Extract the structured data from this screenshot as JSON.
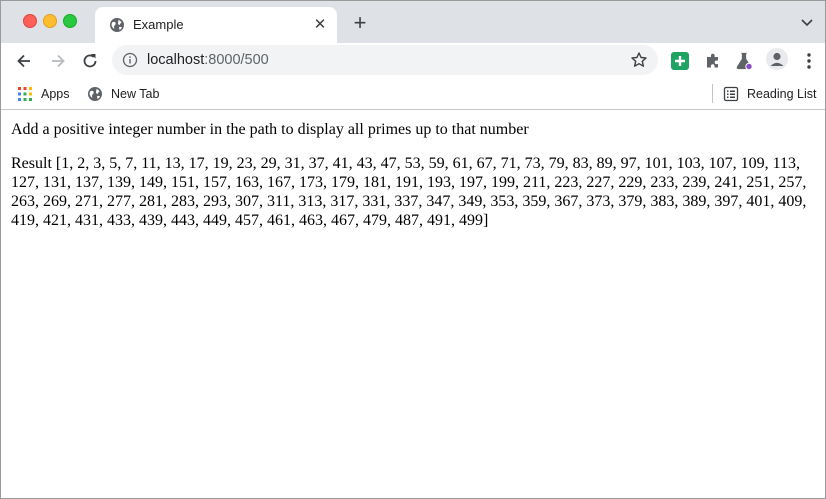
{
  "browser": {
    "tab": {
      "title": "Example",
      "icon": "globe-icon"
    },
    "address": {
      "host": "localhost",
      "path": ":8000/500"
    },
    "bookmarks": [
      {
        "label": "Apps",
        "icon": "apps-grid-icon"
      },
      {
        "label": "New Tab",
        "icon": "globe-icon"
      }
    ],
    "reading_list": {
      "label": "Reading List",
      "icon": "reading-list-icon"
    },
    "colors": {
      "tabstrip": "#dee1e6",
      "omnibox": "#f1f3f4",
      "extension_green": "#1ea362"
    }
  },
  "page": {
    "heading": "Add a positive integer number in the path to display all primes up to that number",
    "result": "Result [1, 2, 3, 5, 7, 11, 13, 17, 19, 23, 29, 31, 37, 41, 43, 47, 53, 59, 61, 67, 71, 73, 79, 83, 89, 97, 101, 103, 107, 109, 113, 127, 131, 137, 139, 149, 151, 157, 163, 167, 173, 179, 181, 191, 193, 197, 199, 211, 223, 227, 229, 233, 239, 241, 251, 257, 263, 269, 271, 277, 281, 283, 293, 307, 311, 313, 317, 331, 337, 347, 349, 353, 359, 367, 373, 379, 383, 389, 397, 401, 409, 419, 421, 431, 433, 439, 443, 449, 457, 461, 463, 467, 479, 487, 491, 499]"
  }
}
